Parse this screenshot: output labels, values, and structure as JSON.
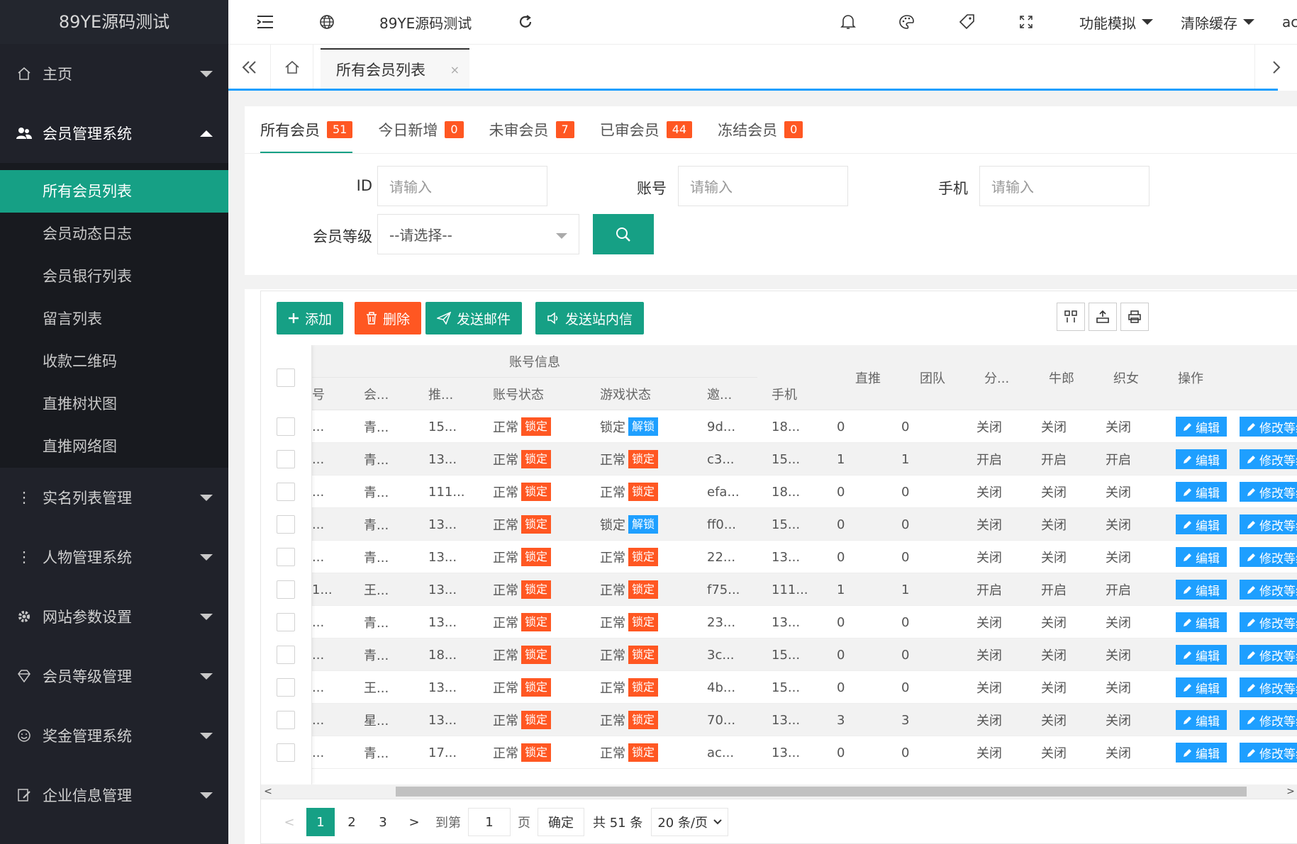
{
  "sidebar": {
    "logo": "89YE源码测试",
    "menus": [
      {
        "label": "主页",
        "icon": "home-icon"
      },
      {
        "label": "会员管理系统",
        "icon": "users-icon"
      }
    ],
    "submenu": [
      "所有会员列表",
      "会员动态日志",
      "会员银行列表",
      "留言列表",
      "收款二维码",
      "直推树状图",
      "直推网络图"
    ],
    "menus_after": [
      {
        "label": "实名列表管理",
        "icon": "dots-icon"
      },
      {
        "label": "人物管理系统",
        "icon": "dots-icon"
      },
      {
        "label": "网站参数设置",
        "icon": "gear-icon"
      },
      {
        "label": "会员等级管理",
        "icon": "diamond-icon"
      },
      {
        "label": "奖金管理系统",
        "icon": "smile-icon"
      },
      {
        "label": "企业信息管理",
        "icon": "edit-icon"
      }
    ]
  },
  "header": {
    "site_name": "89YE源码测试",
    "func_menu": "功能模拟",
    "clear_cache": "清除缓存",
    "user": "ac"
  },
  "tabs": {
    "current": "所有会员列表",
    "close": "×"
  },
  "subtabs": [
    {
      "label": "所有会员",
      "count": "51"
    },
    {
      "label": "今日新增",
      "count": "0"
    },
    {
      "label": "未审会员",
      "count": "7"
    },
    {
      "label": "已审会员",
      "count": "44"
    },
    {
      "label": "冻结会员",
      "count": "0"
    }
  ],
  "filters": {
    "id_label": "ID",
    "account_label": "账号",
    "phone_label": "手机",
    "level_label": "会员等级",
    "placeholder": "请输入",
    "select_placeholder": "--请选择--"
  },
  "toolbar": {
    "add": "添加",
    "delete": "删除",
    "send_mail": "发送邮件",
    "send_msg": "发送站内信"
  },
  "table": {
    "group_header": "账号信息",
    "headers": {
      "col_id": "号",
      "col_member": "会...",
      "col_ref": "推...",
      "account_status": "账号状态",
      "game_status": "游戏状态",
      "invite": "邀...",
      "phone": "手机",
      "direct": "直推",
      "team": "团队",
      "share": "分...",
      "cowherd": "牛郎",
      "weaver": "织女",
      "ops": "操作"
    },
    "labels": {
      "normal": "正常",
      "locked": "锁定",
      "lock": "锁定",
      "unlock": "解锁",
      "edit": "编辑",
      "modify_level": "修改等级"
    },
    "rows": [
      {
        "id": "...",
        "member": "青...",
        "ref": "15...",
        "acct": "正常",
        "game": "锁定",
        "game_btn": "解锁",
        "invite": "9d...",
        "phone": "18...",
        "direct": "0",
        "team": "0",
        "share": "关闭",
        "cowherd": "关闭",
        "weaver": "关闭"
      },
      {
        "id": "...",
        "member": "青...",
        "ref": "13...",
        "acct": "正常",
        "game": "正常",
        "game_btn": "锁定",
        "invite": "c3...",
        "phone": "15...",
        "direct": "1",
        "team": "1",
        "share": "开启",
        "cowherd": "开启",
        "weaver": "开启"
      },
      {
        "id": "...",
        "member": "青...",
        "ref": "111...",
        "acct": "正常",
        "game": "正常",
        "game_btn": "锁定",
        "invite": "efa...",
        "phone": "18...",
        "direct": "0",
        "team": "0",
        "share": "关闭",
        "cowherd": "关闭",
        "weaver": "关闭"
      },
      {
        "id": "...",
        "member": "青...",
        "ref": "13...",
        "acct": "正常",
        "game": "锁定",
        "game_btn": "解锁",
        "invite": "ff0...",
        "phone": "15...",
        "direct": "0",
        "team": "0",
        "share": "关闭",
        "cowherd": "关闭",
        "weaver": "关闭"
      },
      {
        "id": "...",
        "member": "青...",
        "ref": "13...",
        "acct": "正常",
        "game": "正常",
        "game_btn": "锁定",
        "invite": "22...",
        "phone": "13...",
        "direct": "0",
        "team": "0",
        "share": "关闭",
        "cowherd": "关闭",
        "weaver": "关闭"
      },
      {
        "id": "1...",
        "member": "王...",
        "ref": "13...",
        "acct": "正常",
        "game": "正常",
        "game_btn": "锁定",
        "invite": "f75...",
        "phone": "111...",
        "direct": "1",
        "team": "1",
        "share": "开启",
        "cowherd": "开启",
        "weaver": "开启"
      },
      {
        "id": "...",
        "member": "青...",
        "ref": "13...",
        "acct": "正常",
        "game": "正常",
        "game_btn": "锁定",
        "invite": "23...",
        "phone": "13...",
        "direct": "0",
        "team": "0",
        "share": "关闭",
        "cowherd": "关闭",
        "weaver": "关闭"
      },
      {
        "id": "...",
        "member": "青...",
        "ref": "18...",
        "acct": "正常",
        "game": "正常",
        "game_btn": "锁定",
        "invite": "3c...",
        "phone": "15...",
        "direct": "0",
        "team": "0",
        "share": "关闭",
        "cowherd": "关闭",
        "weaver": "关闭"
      },
      {
        "id": "...",
        "member": "王...",
        "ref": "13...",
        "acct": "正常",
        "game": "正常",
        "game_btn": "锁定",
        "invite": "4b...",
        "phone": "15...",
        "direct": "0",
        "team": "0",
        "share": "关闭",
        "cowherd": "关闭",
        "weaver": "关闭"
      },
      {
        "id": "...",
        "member": "星...",
        "ref": "13...",
        "acct": "正常",
        "game": "正常",
        "game_btn": "锁定",
        "invite": "70...",
        "phone": "13...",
        "direct": "3",
        "team": "3",
        "share": "关闭",
        "cowherd": "关闭",
        "weaver": "关闭"
      },
      {
        "id": "...",
        "member": "青...",
        "ref": "17...",
        "acct": "正常",
        "game": "正常",
        "game_btn": "锁定",
        "invite": "ac...",
        "phone": "13...",
        "direct": "0",
        "team": "0",
        "share": "关闭",
        "cowherd": "关闭",
        "weaver": "关闭"
      }
    ]
  },
  "pager": {
    "pages": [
      "1",
      "2",
      "3"
    ],
    "current": "1",
    "goto": "到第",
    "goto_value": "1",
    "page_unit": "页",
    "confirm": "确定",
    "total": "共 51 条",
    "per_page": "20 条/页"
  },
  "colors": {
    "accent": "#16a085",
    "danger": "#ff5722",
    "info": "#1e9fff",
    "sidebar": "#20222a"
  }
}
